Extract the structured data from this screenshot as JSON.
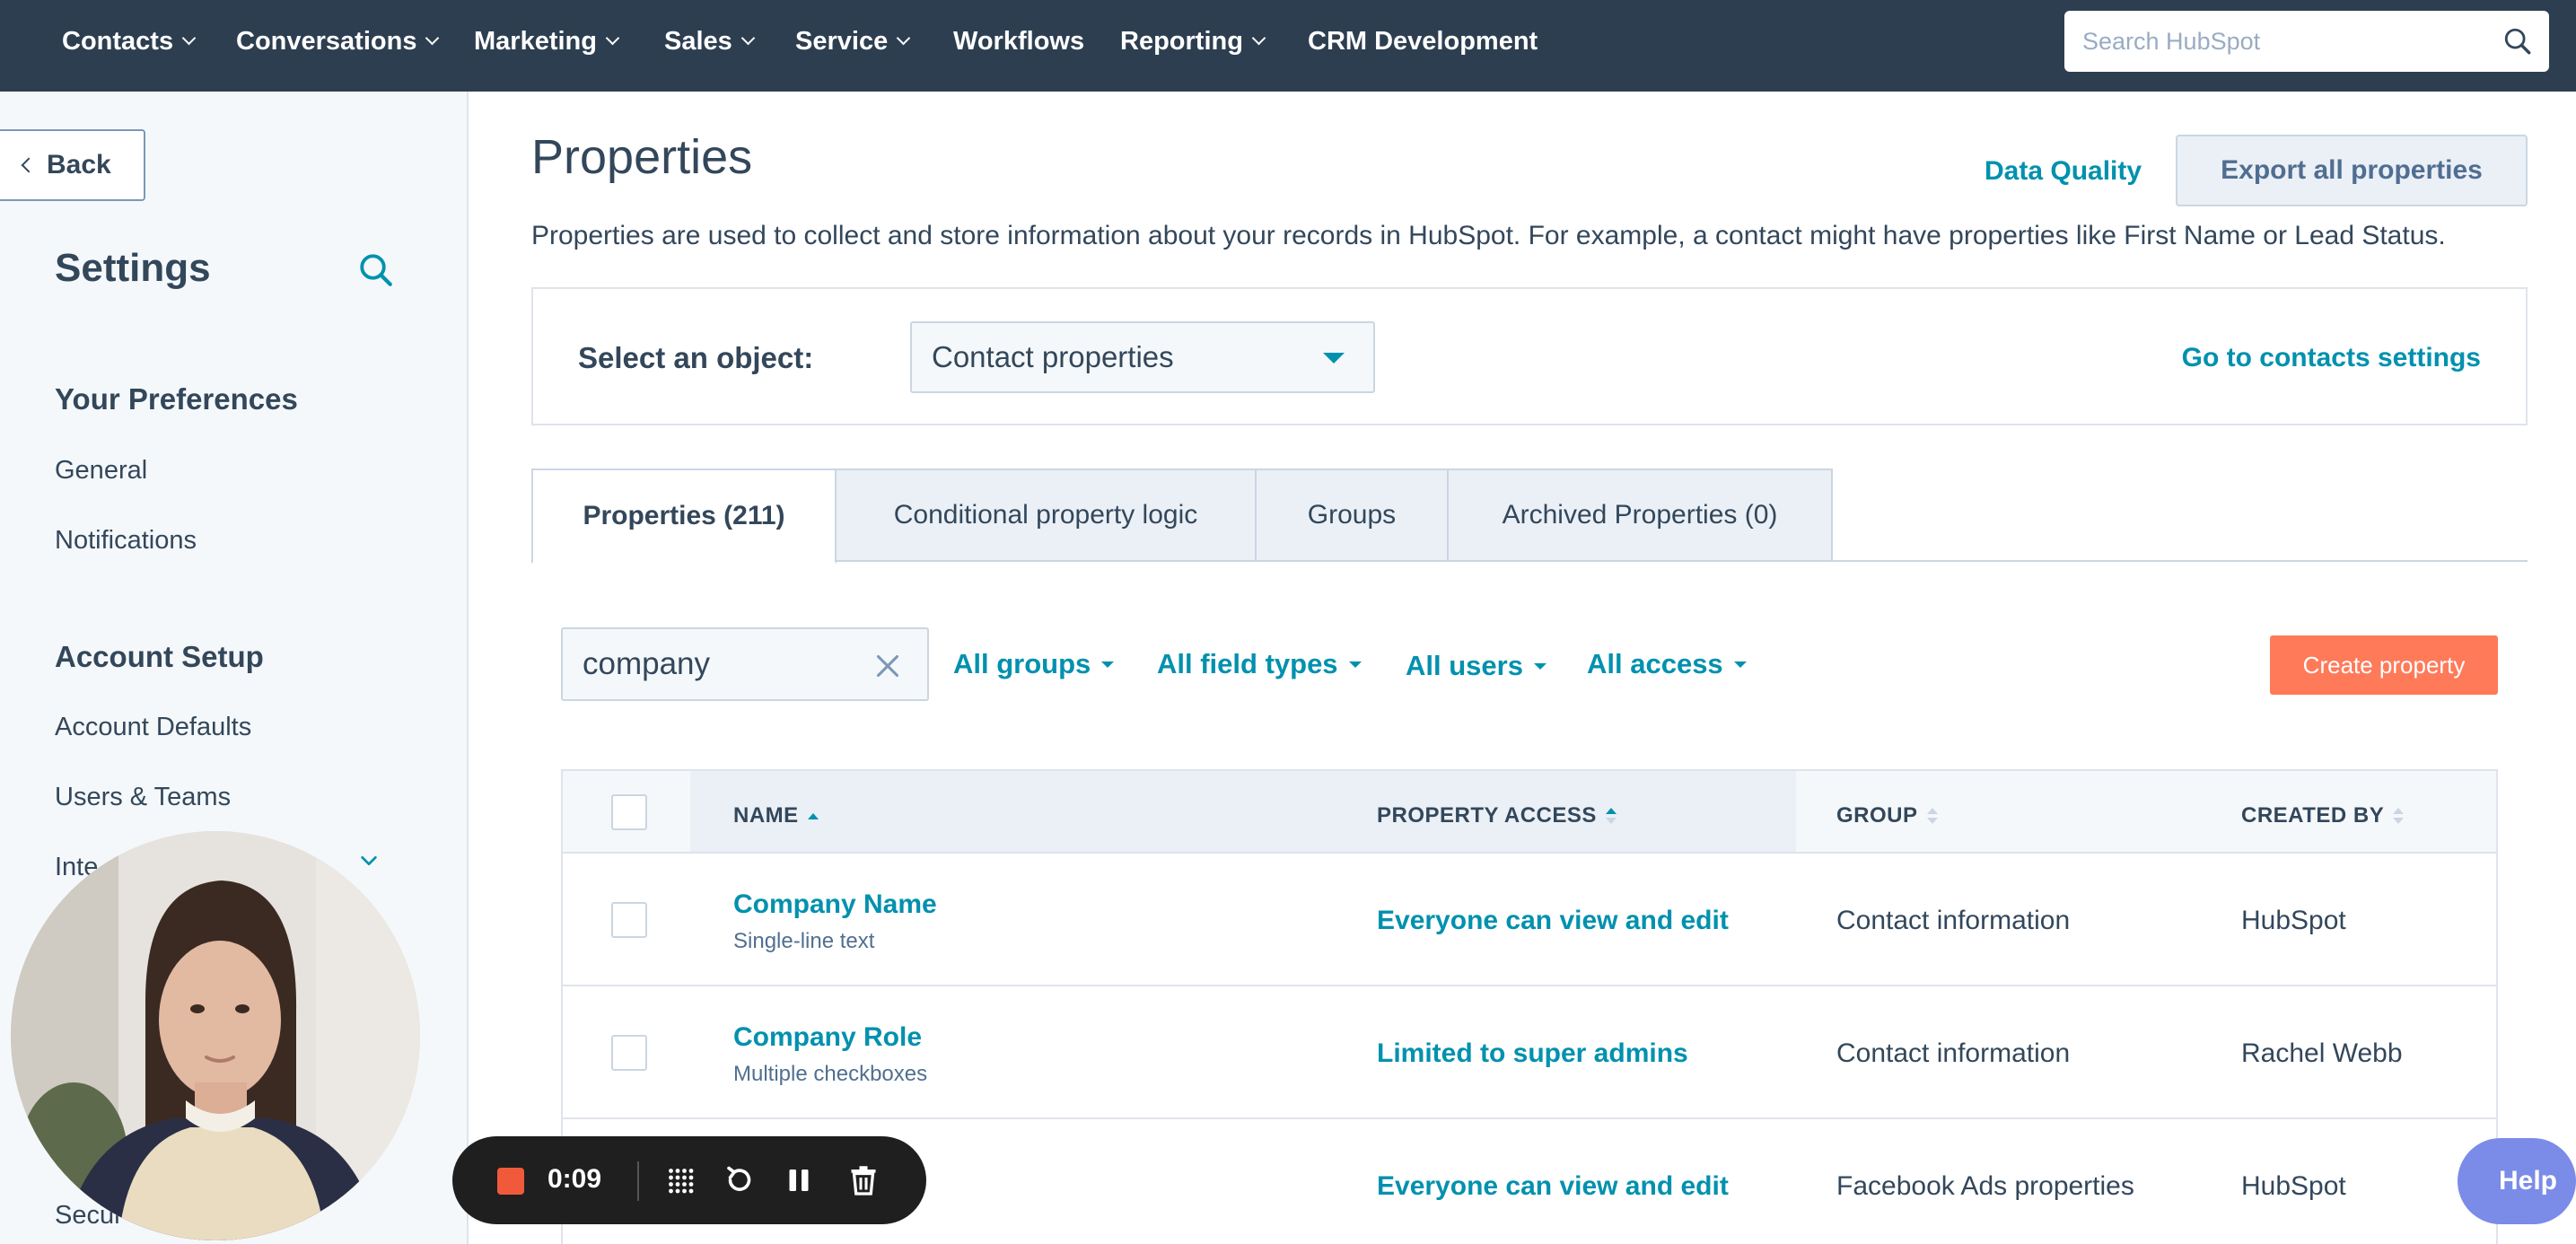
{
  "topnav": {
    "items": [
      {
        "label": "Contacts",
        "has_menu": true
      },
      {
        "label": "Conversations",
        "has_menu": true
      },
      {
        "label": "Marketing",
        "has_menu": true
      },
      {
        "label": "Sales",
        "has_menu": true
      },
      {
        "label": "Service",
        "has_menu": true
      },
      {
        "label": "Workflows",
        "has_menu": false
      },
      {
        "label": "Reporting",
        "has_menu": true
      },
      {
        "label": "CRM Development",
        "has_menu": false
      }
    ],
    "search_placeholder": "Search HubSpot"
  },
  "sidebar": {
    "back_label": "Back",
    "title": "Settings",
    "preferences_heading": "Your Preferences",
    "preferences_links": [
      "General",
      "Notifications"
    ],
    "account_heading": "Account Setup",
    "account_links": [
      "Account Defaults",
      "Users & Teams",
      "Inte",
      "Secur"
    ]
  },
  "main": {
    "title": "Properties",
    "data_quality_link": "Data Quality",
    "export_button": "Export all properties",
    "description": "Properties are used to collect and store information about your records in HubSpot. For example, a contact might have properties like First Name or Lead Status.",
    "object_label": "Select an object:",
    "object_selected": "Contact properties",
    "contacts_settings_link": "Go to contacts settings",
    "tabs": [
      {
        "label": "Properties (211)",
        "active": true
      },
      {
        "label": "Conditional property logic",
        "active": false
      },
      {
        "label": "Groups",
        "active": false
      },
      {
        "label": "Archived Properties (0)",
        "active": false
      }
    ],
    "search_value": "company",
    "filters": [
      "All groups",
      "All field types",
      "All users",
      "All access"
    ],
    "create_button": "Create property"
  },
  "table": {
    "columns": [
      "NAME",
      "PROPERTY ACCESS",
      "GROUP",
      "CREATED BY"
    ],
    "rows": [
      {
        "name": "Company Name",
        "type": "Single-line text",
        "access": "Everyone can view and edit",
        "group": "Contact information",
        "created_by": "HubSpot"
      },
      {
        "name": "Company Role",
        "type": "Multiple checkboxes",
        "access": "Limited to super admins",
        "group": "Contact information",
        "created_by": "Rachel Webb"
      },
      {
        "name": "",
        "type": "",
        "access": "Everyone can view and edit",
        "group": "Facebook Ads properties",
        "created_by": "HubSpot"
      }
    ]
  },
  "recorder": {
    "time": "0:09",
    "stop_color": "#f05a3b"
  },
  "help_label": "Help",
  "colors": {
    "nav_bg": "#2d3e50",
    "link": "#0091ae",
    "primary_cta": "#ff7a59",
    "text": "#33475b",
    "help_bg": "#7b8be8"
  }
}
